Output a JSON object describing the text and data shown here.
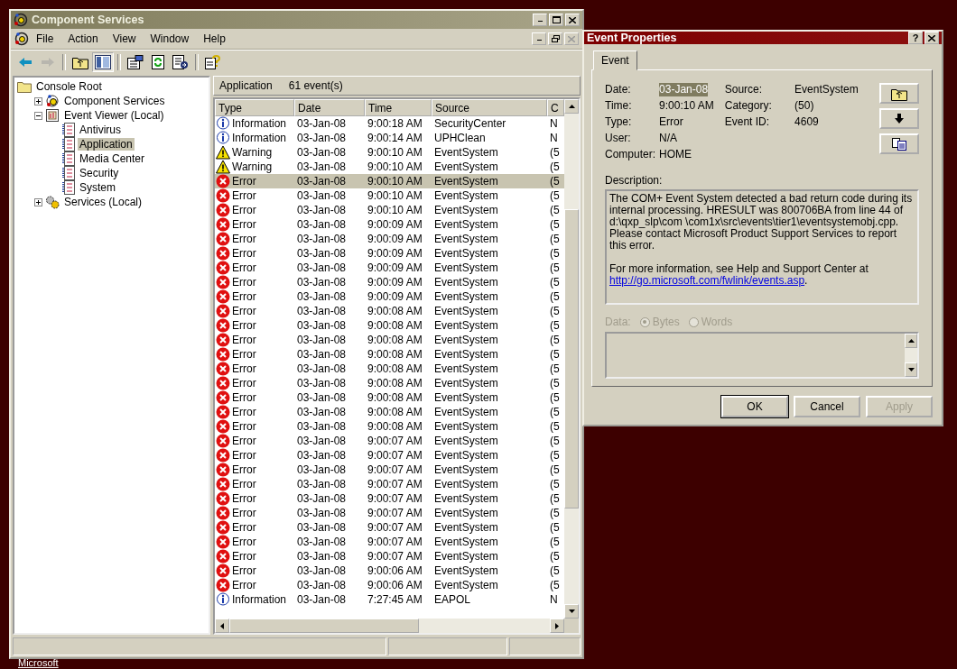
{
  "main_window": {
    "title": "Component Services",
    "menu": [
      "File",
      "Action",
      "View",
      "Window",
      "Help"
    ],
    "toolbar": [
      {
        "kind": "back",
        "disabled": false,
        "pressed": false
      },
      {
        "kind": "forward",
        "disabled": true,
        "pressed": false
      },
      {
        "kind": "up",
        "disabled": false,
        "pressed": false
      },
      {
        "kind": "tree",
        "disabled": false,
        "pressed": true
      },
      {
        "kind": "properties",
        "disabled": false,
        "pressed": false
      },
      {
        "kind": "refresh",
        "disabled": false,
        "pressed": false
      },
      {
        "kind": "export",
        "disabled": false,
        "pressed": false
      },
      {
        "kind": "help",
        "disabled": false,
        "pressed": false
      }
    ]
  },
  "tree": [
    {
      "label": "Console Root",
      "kind": "folder",
      "selected": false,
      "children": [
        {
          "label": "Component Services",
          "kind": "component",
          "selected": false,
          "expanded": false
        },
        {
          "label": "Event Viewer (Local)",
          "kind": "viewer",
          "selected": false,
          "expanded": true,
          "children": [
            {
              "label": "Antivirus",
              "kind": "log",
              "selected": false
            },
            {
              "label": "Application",
              "kind": "log",
              "selected": true
            },
            {
              "label": "Media Center",
              "kind": "log",
              "selected": false
            },
            {
              "label": "Security",
              "kind": "log",
              "selected": false
            },
            {
              "label": "System",
              "kind": "log",
              "selected": false
            }
          ]
        },
        {
          "label": "Services (Local)",
          "kind": "services",
          "selected": false,
          "expanded": false
        }
      ]
    }
  ],
  "list_header": {
    "title": "Application",
    "count": "61 event(s)"
  },
  "table": {
    "columns": [
      "Type",
      "Date",
      "Time",
      "Source",
      "C"
    ],
    "rows": [
      {
        "kind": "information",
        "type": "Information",
        "date": "03-Jan-08",
        "time": "9:00:18 AM",
        "source": "SecurityCenter",
        "column_5": "N",
        "selected": false
      },
      {
        "kind": "information",
        "type": "Information",
        "date": "03-Jan-08",
        "time": "9:00:14 AM",
        "source": "UPHClean",
        "column_5": "N",
        "selected": false
      },
      {
        "kind": "warning",
        "type": "Warning",
        "date": "03-Jan-08",
        "time": "9:00:10 AM",
        "source": "EventSystem",
        "column_5": "(5",
        "selected": false
      },
      {
        "kind": "warning",
        "type": "Warning",
        "date": "03-Jan-08",
        "time": "9:00:10 AM",
        "source": "EventSystem",
        "column_5": "(5",
        "selected": false
      },
      {
        "kind": "error",
        "type": "Error",
        "date": "03-Jan-08",
        "time": "9:00:10 AM",
        "source": "EventSystem",
        "column_5": "(5",
        "selected": true
      },
      {
        "kind": "error",
        "type": "Error",
        "date": "03-Jan-08",
        "time": "9:00:10 AM",
        "source": "EventSystem",
        "column_5": "(5",
        "selected": false
      },
      {
        "kind": "error",
        "type": "Error",
        "date": "03-Jan-08",
        "time": "9:00:10 AM",
        "source": "EventSystem",
        "column_5": "(5",
        "selected": false
      },
      {
        "kind": "error",
        "type": "Error",
        "date": "03-Jan-08",
        "time": "9:00:09 AM",
        "source": "EventSystem",
        "column_5": "(5",
        "selected": false
      },
      {
        "kind": "error",
        "type": "Error",
        "date": "03-Jan-08",
        "time": "9:00:09 AM",
        "source": "EventSystem",
        "column_5": "(5",
        "selected": false
      },
      {
        "kind": "error",
        "type": "Error",
        "date": "03-Jan-08",
        "time": "9:00:09 AM",
        "source": "EventSystem",
        "column_5": "(5",
        "selected": false
      },
      {
        "kind": "error",
        "type": "Error",
        "date": "03-Jan-08",
        "time": "9:00:09 AM",
        "source": "EventSystem",
        "column_5": "(5",
        "selected": false
      },
      {
        "kind": "error",
        "type": "Error",
        "date": "03-Jan-08",
        "time": "9:00:09 AM",
        "source": "EventSystem",
        "column_5": "(5",
        "selected": false
      },
      {
        "kind": "error",
        "type": "Error",
        "date": "03-Jan-08",
        "time": "9:00:09 AM",
        "source": "EventSystem",
        "column_5": "(5",
        "selected": false
      },
      {
        "kind": "error",
        "type": "Error",
        "date": "03-Jan-08",
        "time": "9:00:08 AM",
        "source": "EventSystem",
        "column_5": "(5",
        "selected": false
      },
      {
        "kind": "error",
        "type": "Error",
        "date": "03-Jan-08",
        "time": "9:00:08 AM",
        "source": "EventSystem",
        "column_5": "(5",
        "selected": false
      },
      {
        "kind": "error",
        "type": "Error",
        "date": "03-Jan-08",
        "time": "9:00:08 AM",
        "source": "EventSystem",
        "column_5": "(5",
        "selected": false
      },
      {
        "kind": "error",
        "type": "Error",
        "date": "03-Jan-08",
        "time": "9:00:08 AM",
        "source": "EventSystem",
        "column_5": "(5",
        "selected": false
      },
      {
        "kind": "error",
        "type": "Error",
        "date": "03-Jan-08",
        "time": "9:00:08 AM",
        "source": "EventSystem",
        "column_5": "(5",
        "selected": false
      },
      {
        "kind": "error",
        "type": "Error",
        "date": "03-Jan-08",
        "time": "9:00:08 AM",
        "source": "EventSystem",
        "column_5": "(5",
        "selected": false
      },
      {
        "kind": "error",
        "type": "Error",
        "date": "03-Jan-08",
        "time": "9:00:08 AM",
        "source": "EventSystem",
        "column_5": "(5",
        "selected": false
      },
      {
        "kind": "error",
        "type": "Error",
        "date": "03-Jan-08",
        "time": "9:00:08 AM",
        "source": "EventSystem",
        "column_5": "(5",
        "selected": false
      },
      {
        "kind": "error",
        "type": "Error",
        "date": "03-Jan-08",
        "time": "9:00:08 AM",
        "source": "EventSystem",
        "column_5": "(5",
        "selected": false
      },
      {
        "kind": "error",
        "type": "Error",
        "date": "03-Jan-08",
        "time": "9:00:07 AM",
        "source": "EventSystem",
        "column_5": "(5",
        "selected": false
      },
      {
        "kind": "error",
        "type": "Error",
        "date": "03-Jan-08",
        "time": "9:00:07 AM",
        "source": "EventSystem",
        "column_5": "(5",
        "selected": false
      },
      {
        "kind": "error",
        "type": "Error",
        "date": "03-Jan-08",
        "time": "9:00:07 AM",
        "source": "EventSystem",
        "column_5": "(5",
        "selected": false
      },
      {
        "kind": "error",
        "type": "Error",
        "date": "03-Jan-08",
        "time": "9:00:07 AM",
        "source": "EventSystem",
        "column_5": "(5",
        "selected": false
      },
      {
        "kind": "error",
        "type": "Error",
        "date": "03-Jan-08",
        "time": "9:00:07 AM",
        "source": "EventSystem",
        "column_5": "(5",
        "selected": false
      },
      {
        "kind": "error",
        "type": "Error",
        "date": "03-Jan-08",
        "time": "9:00:07 AM",
        "source": "EventSystem",
        "column_5": "(5",
        "selected": false
      },
      {
        "kind": "error",
        "type": "Error",
        "date": "03-Jan-08",
        "time": "9:00:07 AM",
        "source": "EventSystem",
        "column_5": "(5",
        "selected": false
      },
      {
        "kind": "error",
        "type": "Error",
        "date": "03-Jan-08",
        "time": "9:00:07 AM",
        "source": "EventSystem",
        "column_5": "(5",
        "selected": false
      },
      {
        "kind": "error",
        "type": "Error",
        "date": "03-Jan-08",
        "time": "9:00:07 AM",
        "source": "EventSystem",
        "column_5": "(5",
        "selected": false
      },
      {
        "kind": "error",
        "type": "Error",
        "date": "03-Jan-08",
        "time": "9:00:06 AM",
        "source": "EventSystem",
        "column_5": "(5",
        "selected": false
      },
      {
        "kind": "error",
        "type": "Error",
        "date": "03-Jan-08",
        "time": "9:00:06 AM",
        "source": "EventSystem",
        "column_5": "(5",
        "selected": false
      },
      {
        "kind": "information",
        "type": "Information",
        "date": "03-Jan-08",
        "time": "7:27:45 AM",
        "source": "EAPOL",
        "column_5": "N",
        "selected": false
      }
    ]
  },
  "dialog": {
    "title": "Event Properties",
    "tabs": [
      {
        "label": "Event",
        "selected": true
      }
    ],
    "left_fields": [
      {
        "label": "Date:",
        "value": "03-Jan-08",
        "selected": true
      },
      {
        "label": "Time:",
        "value": "9:00:10 AM",
        "selected": false
      },
      {
        "label": "Type:",
        "value": "Error",
        "selected": false
      },
      {
        "label": "User:",
        "value": "N/A",
        "selected": false
      },
      {
        "label": "Computer:",
        "value": "HOME",
        "selected": false
      }
    ],
    "right_fields": [
      {
        "label": "Source:",
        "value": "EventSystem"
      },
      {
        "label": "Category:",
        "value": "(50)"
      },
      {
        "label": "Event ID:",
        "value": "4609"
      }
    ],
    "side_buttons": [
      {
        "kind": "up"
      },
      {
        "kind": "down"
      },
      {
        "kind": "copy"
      }
    ],
    "description_label": "Description:",
    "description": "The COM+ Event System detected a bad return code during its internal processing.  HRESULT was 800706BA from line 44 of d:\\qxp_slp\\com \\com1x\\src\\events\\tier1\\eventsystemobj.cpp.  Please contact Microsoft Product Support Services to report this error.",
    "more_info": "For more information, see Help and Support Center at",
    "link": "http://go.microsoft.com/fwlink/events.asp",
    "link_suffix": ".",
    "help_button": "?",
    "data_label": "Data:",
    "data_disabled": true,
    "radios": [
      {
        "label": "Bytes",
        "selected": true
      },
      {
        "label": "Words",
        "selected": false
      }
    ],
    "buttons": [
      {
        "label": "OK",
        "default": true,
        "disabled": false
      },
      {
        "label": "Cancel",
        "default": false,
        "disabled": false
      },
      {
        "label": "Apply",
        "default": false,
        "disabled": true
      }
    ]
  },
  "desktop_label": "Microsoft"
}
